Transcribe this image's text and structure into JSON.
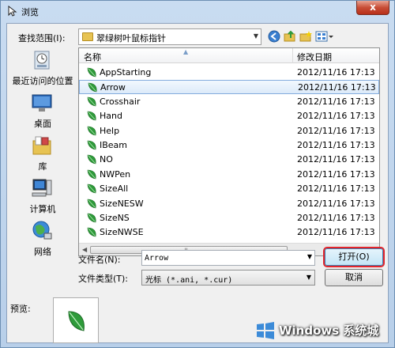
{
  "window": {
    "title": "浏览",
    "close_glyph": "x"
  },
  "lookin": {
    "label": "查找范围(I):",
    "value": "翠绿树叶鼠标指针"
  },
  "toolbar": {
    "icons": [
      "back-icon",
      "up-folder-icon",
      "new-folder-icon",
      "view-menu-icon"
    ]
  },
  "places": [
    {
      "label": "最近访问的位置",
      "icon": "recent-places-icon"
    },
    {
      "label": "桌面",
      "icon": "desktop-icon"
    },
    {
      "label": "库",
      "icon": "libraries-icon"
    },
    {
      "label": "计算机",
      "icon": "computer-icon"
    },
    {
      "label": "网络",
      "icon": "network-icon"
    }
  ],
  "list": {
    "col_name": "名称",
    "col_date": "修改日期",
    "rows": [
      {
        "name": "AppStarting",
        "date": "2012/11/16 17:13"
      },
      {
        "name": "Arrow",
        "date": "2012/11/16 17:13",
        "selected": true
      },
      {
        "name": "Crosshair",
        "date": "2012/11/16 17:13"
      },
      {
        "name": "Hand",
        "date": "2012/11/16 17:13"
      },
      {
        "name": "Help",
        "date": "2012/11/16 17:13"
      },
      {
        "name": "IBeam",
        "date": "2012/11/16 17:13"
      },
      {
        "name": "NO",
        "date": "2012/11/16 17:13"
      },
      {
        "name": "NWPen",
        "date": "2012/11/16 17:13"
      },
      {
        "name": "SizeAll",
        "date": "2012/11/16 17:13"
      },
      {
        "name": "SizeNESW",
        "date": "2012/11/16 17:13"
      },
      {
        "name": "SizeNS",
        "date": "2012/11/16 17:13"
      },
      {
        "name": "SizeNWSE",
        "date": "2012/11/16 17:13"
      }
    ]
  },
  "filename": {
    "label": "文件名(N):",
    "value": "Arrow"
  },
  "filetype": {
    "label": "文件类型(T):",
    "value": "光标 (*.ani, *.cur)"
  },
  "buttons": {
    "open": "打开(O)",
    "cancel": "取消"
  },
  "preview": {
    "label": "预览:"
  },
  "watermark": {
    "text": "Windows 系统城"
  },
  "colors": {
    "leaf": "#2e9b3a",
    "highlight": "#e3242b",
    "accent": "#84acdd"
  }
}
